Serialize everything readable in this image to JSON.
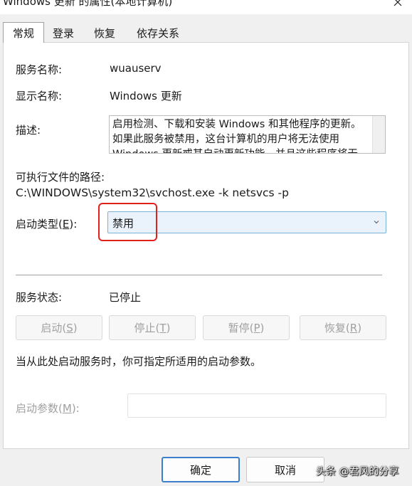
{
  "window": {
    "title": "Windows 更新 的属性(本地计算机)"
  },
  "tabs": [
    {
      "label": "常规",
      "active": true
    },
    {
      "label": "登录",
      "active": false
    },
    {
      "label": "恢复",
      "active": false
    },
    {
      "label": "依存关系",
      "active": false
    }
  ],
  "general": {
    "service_name_label": "服务名称:",
    "service_name": "wuauserv",
    "display_name_label": "显示名称:",
    "display_name": "Windows 更新",
    "description_label": "描述:",
    "description": "启用检测、下载和安装 Windows 和其他程序的更新。如果此服务被禁用，这台计算机的用户将无法使用 Windows 更新或其自动更新功能，并且这些程序将无法使用 Windows 更新代理(WUA) API。",
    "path_label": "可执行文件的路径:",
    "path": "C:\\WINDOWS\\system32\\svchost.exe -k netsvcs -p",
    "startup_type_label_pre": "启动类型(",
    "startup_type_label_key": "E",
    "startup_type_label_post": "):",
    "startup_type_value": "禁用",
    "service_status_label": "服务状态:",
    "service_status": "已停止",
    "hint": "当从此处启动服务时，你可指定所适用的启动参数。",
    "params_label_pre": "启动参数(",
    "params_label_key": "M",
    "params_label_post": "):",
    "params_value": ""
  },
  "service_buttons": [
    {
      "pre": "启动(",
      "key": "S",
      "post": ")"
    },
    {
      "pre": "停止(",
      "key": "T",
      "post": ")"
    },
    {
      "pre": "暂停(",
      "key": "P",
      "post": ")"
    },
    {
      "pre": "恢复(",
      "key": "R",
      "post": ")"
    }
  ],
  "dialog_buttons": {
    "ok": "确定",
    "cancel": "取消"
  },
  "watermark": "头条 @君风的分享",
  "colors": {
    "highlight": "#e0201b",
    "accent": "#3b7fcc",
    "combo_bg": "#eaf3fb"
  },
  "icons": {
    "close": "close-icon",
    "dropdown": "chevron-down-icon"
  }
}
